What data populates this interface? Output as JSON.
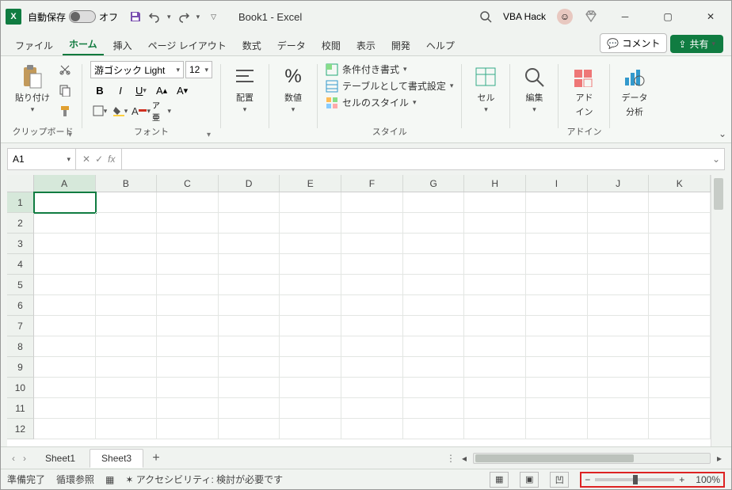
{
  "title": {
    "autosave_label": "自動保存",
    "autosave_state": "オフ",
    "doc": "Book1  -  Excel",
    "user": "VBA Hack"
  },
  "tabs": {
    "file": "ファイル",
    "home": "ホーム",
    "insert": "挿入",
    "pagelayout": "ページ レイアウト",
    "formulas": "数式",
    "data": "データ",
    "review": "校閲",
    "view": "表示",
    "developer": "開発",
    "help": "ヘルプ",
    "comment": "コメント",
    "share": "共有"
  },
  "ribbon": {
    "clipboard": {
      "paste": "貼り付け",
      "label": "クリップボード"
    },
    "font": {
      "name": "游ゴシック Light",
      "size": "12",
      "label": "フォント"
    },
    "align": {
      "btn": "配置"
    },
    "number": {
      "btn": "数値"
    },
    "styles": {
      "cond": "条件付き書式",
      "table": "テーブルとして書式設定",
      "cell": "セルのスタイル",
      "label": "スタイル"
    },
    "cells": {
      "btn": "セル"
    },
    "editing": {
      "btn": "編集"
    },
    "addin": {
      "btn1": "アド",
      "btn1b": "イン",
      "label": "アドイン"
    },
    "analysis": {
      "btn1": "データ",
      "btn1b": "分析"
    }
  },
  "namebox": "A1",
  "columns": [
    "A",
    "B",
    "C",
    "D",
    "E",
    "F",
    "G",
    "H",
    "I",
    "J",
    "K"
  ],
  "rows": [
    "1",
    "2",
    "3",
    "4",
    "5",
    "6",
    "7",
    "8",
    "9",
    "10",
    "11",
    "12"
  ],
  "sheets": {
    "s1": "Sheet1",
    "s3": "Sheet3"
  },
  "status": {
    "ready": "準備完了",
    "circ": "循環参照",
    "acc": "アクセシビリティ: 検討が必要です",
    "zoom": "100%"
  }
}
